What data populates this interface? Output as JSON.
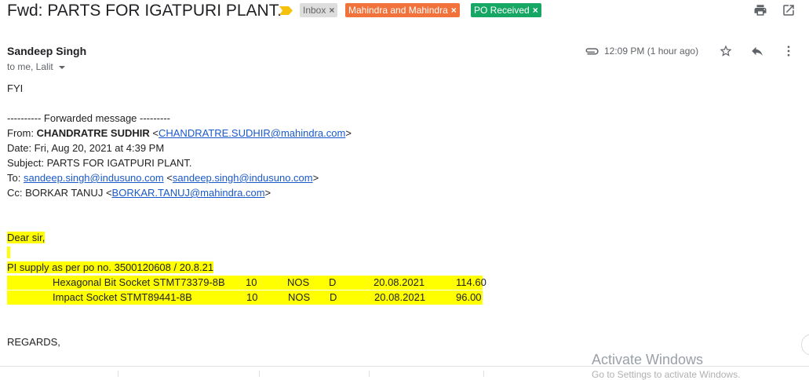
{
  "subject": "Fwd: PARTS FOR IGATPURI PLANT.",
  "labels": {
    "inbox": "Inbox",
    "mahindra": "Mahindra and Mahindra",
    "po": "PO Received",
    "remove": "×"
  },
  "colors": {
    "inbox_bg": "#dddddd",
    "mahindra_bg": "#f2723c",
    "po_bg": "#16a765",
    "link": "#1a59c9",
    "highlight": "#ffff00"
  },
  "header": {
    "sender": "Sandeep Singh",
    "recipients": "to me, Lalit",
    "timestamp": "12:09 PM (1 hour ago)"
  },
  "icons": {
    "print": "print-icon",
    "open_new_window": "open-in-new-window-icon",
    "attachment": "paperclip-icon",
    "star": "star-icon",
    "reply": "reply-icon",
    "more": "more-vert-icon",
    "important": "important-marker-icon"
  },
  "body": {
    "fyi": "FYI",
    "forward_header": "---------- Forwarded message ---------",
    "from_label": "From: ",
    "from_name": "CHANDRATRE SUDHIR",
    "from_email": "CHANDRATRE.SUDHIR@mahindra.com",
    "date": "Date: Fri, Aug 20, 2021 at 4:39 PM",
    "subject": "Subject: PARTS FOR IGATPURI PLANT.",
    "to_label": "To: ",
    "to_email": "sandeep.singh@indusuno.com",
    "cc_label": "Cc: BORKAR TANUJ ",
    "cc_email": "BORKAR.TANUJ@mahindra.com",
    "greeting": "Dear sir,",
    "po_line": "PI supply as per po no.  3500120608 /  20.8.21",
    "items": [
      {
        "desc": "Hexagonal Bit Socket STMT73379-8B",
        "qty": "10",
        "unit": "NOS",
        "code": "D",
        "date": "20.08.2021",
        "amount": "114.60"
      },
      {
        "desc": "Impact Socket STMT89441-8B",
        "qty": "10",
        "unit": "NOS",
        "code": "D",
        "date": "20.08.2021",
        "amount": "96.00"
      }
    ],
    "regards": "REGARDS,"
  },
  "overlay": {
    "activate_title": "Activate Windows",
    "activate_sub": "Go to Settings to activate Windows."
  }
}
